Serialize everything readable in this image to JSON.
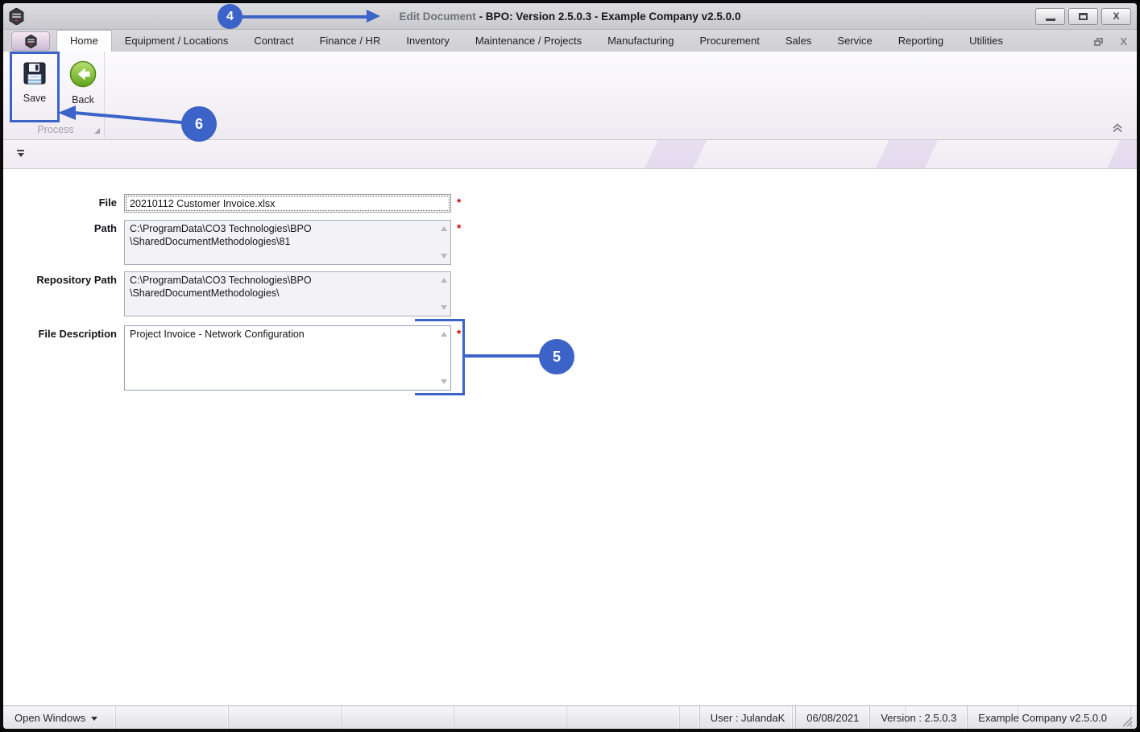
{
  "window": {
    "title_doc": "Edit Document",
    "title_rest": "- BPO: Version 2.5.0.3 - Example Company v2.5.0.0"
  },
  "tabs": [
    {
      "label": "Home",
      "active": true
    },
    {
      "label": "Equipment / Locations"
    },
    {
      "label": "Contract"
    },
    {
      "label": "Finance / HR"
    },
    {
      "label": "Inventory"
    },
    {
      "label": "Maintenance / Projects"
    },
    {
      "label": "Manufacturing"
    },
    {
      "label": "Procurement"
    },
    {
      "label": "Sales"
    },
    {
      "label": "Service"
    },
    {
      "label": "Reporting"
    },
    {
      "label": "Utilities"
    }
  ],
  "ribbon": {
    "save_label": "Save",
    "back_label": "Back",
    "group_label": "Process"
  },
  "form": {
    "file": {
      "label": "File",
      "value": "20210112 Customer Invoice.xlsx",
      "required": "*"
    },
    "path": {
      "label": "Path",
      "value": "C:\\ProgramData\\CO3 Technologies\\BPO\n\\SharedDocumentMethodologies\\81",
      "required": "*"
    },
    "repository_path": {
      "label": "Repository Path",
      "value": "C:\\ProgramData\\CO3 Technologies\\BPO\n\\SharedDocumentMethodologies\\"
    },
    "file_description": {
      "label": "File Description",
      "value": "Project Invoice - Network Configuration",
      "required": "*"
    }
  },
  "callouts": {
    "four": "4",
    "five": "5",
    "six": "6"
  },
  "status_bar": {
    "open_windows": "Open Windows",
    "user": "User : JulandaK",
    "date": "06/08/2021",
    "version": "Version : 2.5.0.3",
    "company": "Example Company v2.5.0.0"
  },
  "colors": {
    "accent_blue": "#3b63c8",
    "required_red": "#d40000"
  }
}
